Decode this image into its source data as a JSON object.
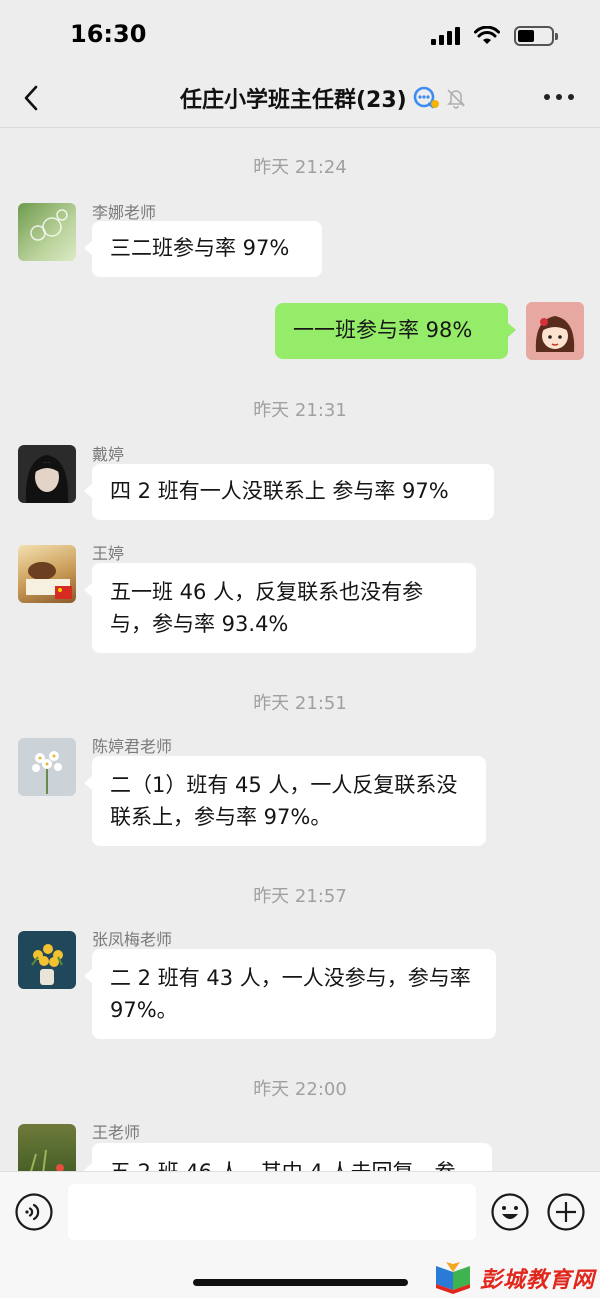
{
  "status_bar": {
    "time": "16:30"
  },
  "header": {
    "title": "任庄小学班主任群(23)"
  },
  "chat": {
    "items": [
      {
        "type": "timestamp",
        "text": "昨天 21:24"
      },
      {
        "type": "message",
        "sender": "李娜老师",
        "text": "三二班参与率 97%"
      },
      {
        "type": "message",
        "self": true,
        "text": "一一班参与率 98%"
      },
      {
        "type": "timestamp",
        "text": "昨天 21:31"
      },
      {
        "type": "message",
        "sender": "戴婷",
        "text": "四 2 班有一人没联系上 参与率 97%"
      },
      {
        "type": "message",
        "sender": "王婷",
        "text": "五一班 46 人，反复联系也没有参与，参与率 93.4%"
      },
      {
        "type": "timestamp",
        "text": "昨天 21:51"
      },
      {
        "type": "message",
        "sender": "陈婷君老师",
        "text": "二（1）班有 45 人，一人反复联系没联系上，参与率 97%。"
      },
      {
        "type": "timestamp",
        "text": "昨天 21:57"
      },
      {
        "type": "message",
        "sender": "张凤梅老师",
        "text": "二 2 班有 43 人，一人没参与，参与率 97%。"
      },
      {
        "type": "timestamp",
        "text": "昨天 22:00"
      },
      {
        "type": "message",
        "sender": "王老师",
        "text": "五 2 班 46 人，其中 4 人未回复，参"
      }
    ]
  },
  "watermark": {
    "text": "彭城教育网"
  },
  "colors": {
    "background": "#ededed",
    "self_bubble": "#95ec69",
    "other_bubble": "#ffffff",
    "watermark": "#e1261c"
  }
}
